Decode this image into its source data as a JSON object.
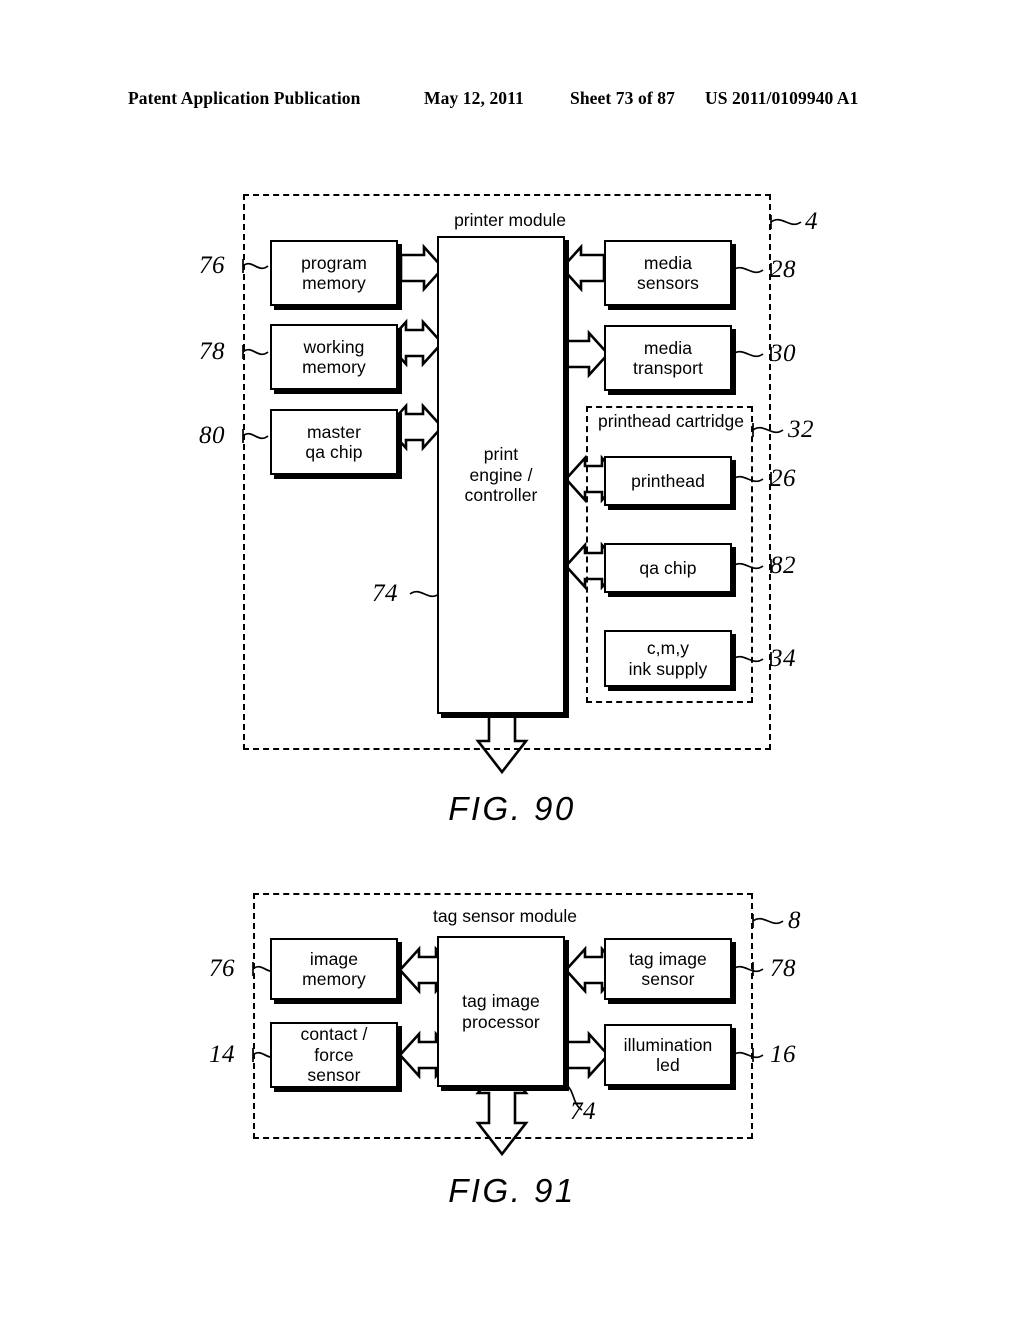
{
  "header": {
    "title": "Patent Application Publication",
    "date": "May 12, 2011",
    "sheet": "Sheet 73 of 87",
    "number": "US 2011/0109940 A1"
  },
  "figures": [
    {
      "caption": "FIG. 90",
      "module_label": "printer module",
      "module_ref": "4",
      "bus_ref": "74",
      "sub_module_label": "printhead cartridge",
      "sub_module_ref": "32",
      "center_block": "print engine / controller",
      "center_block_lines": [
        "print",
        "engine /",
        "controller"
      ],
      "left_blocks": [
        {
          "lines": [
            "program",
            "memory"
          ],
          "ref": "76",
          "arrow": "right"
        },
        {
          "lines": [
            "working",
            "memory"
          ],
          "ref": "78",
          "arrow": "both"
        },
        {
          "lines": [
            "master",
            "qa chip"
          ],
          "ref": "80",
          "arrow": "both"
        }
      ],
      "right_blocks": [
        {
          "lines": [
            "media",
            "sensors"
          ],
          "ref": "28",
          "arrow": "left"
        },
        {
          "lines": [
            "media",
            "transport"
          ],
          "ref": "30",
          "arrow": "right"
        },
        {
          "lines": [
            "printhead"
          ],
          "ref": "26",
          "arrow": "both"
        },
        {
          "lines": [
            "qa chip"
          ],
          "ref": "82",
          "arrow": "both"
        },
        {
          "lines": [
            "c,m,y",
            "ink supply"
          ],
          "ref": "34",
          "arrow": "none"
        }
      ]
    },
    {
      "caption": "FIG. 91",
      "module_label": "tag sensor module",
      "module_ref": "8",
      "bus_ref": "74",
      "center_block": "tag image processor",
      "center_block_lines": [
        "tag image",
        "processor"
      ],
      "left_blocks": [
        {
          "lines": [
            "image",
            "memory"
          ],
          "ref": "76",
          "arrow": "both"
        },
        {
          "lines": [
            "contact /",
            "force",
            "sensor"
          ],
          "ref": "14",
          "arrow": "both"
        }
      ],
      "right_blocks": [
        {
          "lines": [
            "tag image",
            "sensor"
          ],
          "ref": "78",
          "arrow": "both"
        },
        {
          "lines": [
            "illumination",
            "led"
          ],
          "ref": "16",
          "arrow": "right"
        }
      ]
    }
  ]
}
